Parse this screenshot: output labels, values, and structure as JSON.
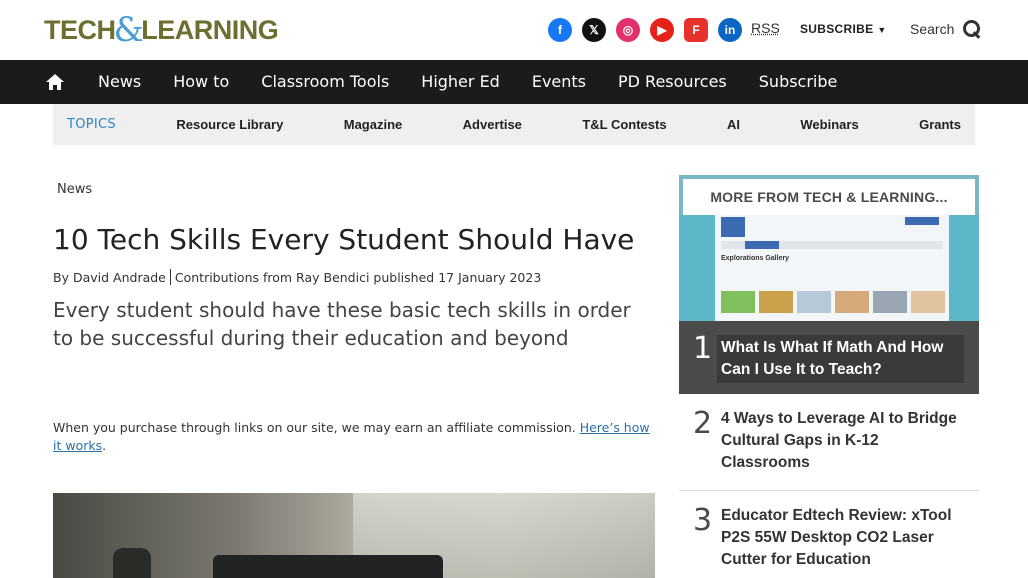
{
  "header": {
    "logo": {
      "part1": "TECH",
      "amp": "&",
      "part2": "LEARNING"
    },
    "socials": [
      {
        "icon": "facebook-icon",
        "glyph": "f"
      },
      {
        "icon": "x-icon",
        "glyph": "𝕏"
      },
      {
        "icon": "instagram-icon",
        "glyph": "◎"
      },
      {
        "icon": "youtube-icon",
        "glyph": "▶"
      },
      {
        "icon": "flipboard-icon",
        "glyph": "F"
      },
      {
        "icon": "linkedin-icon",
        "glyph": "in"
      }
    ],
    "rss": "RSS",
    "subscribe": "SUBSCRIBE",
    "search": "Search"
  },
  "nav": {
    "items": [
      "News",
      "How to",
      "Classroom Tools",
      "Higher Ed",
      "Events",
      "PD Resources",
      "Subscribe"
    ]
  },
  "topics": {
    "label": "TOPICS",
    "items": [
      "Resource Library",
      "Magazine",
      "Advertise",
      "T&L Contests",
      "AI",
      "Webinars",
      "Grants"
    ]
  },
  "article": {
    "breadcrumb": "News",
    "title": "10 Tech Skills Every Student Should Have",
    "byline": {
      "by": "By",
      "author": "David Andrade",
      "contrib_prefix": "Contributions from",
      "contributor": "Ray Bendici",
      "published_prefix": "published",
      "date": "17 January 2023"
    },
    "strapline": "Every student should have these basic tech skills in order to be successful during their education and beyond",
    "affiliate": {
      "text": "When you purchase through links on our site, we may earn an affiliate commission.",
      "link": "Here’s how it works",
      "end": "."
    }
  },
  "sidebar": {
    "header": "MORE FROM TECH & LEARNING...",
    "thumb_title": "Explorations Gallery",
    "items": [
      {
        "num": "1",
        "title": "What Is What If Math And How Can I Use It to Teach?"
      },
      {
        "num": "2",
        "title": "4 Ways to Leverage AI to Bridge Cultural Gaps in K-12 Classrooms"
      },
      {
        "num": "3",
        "title": "Educator Edtech Review: xTool P2S 55W Desktop CO2 Laser Cutter for Education"
      }
    ]
  }
}
